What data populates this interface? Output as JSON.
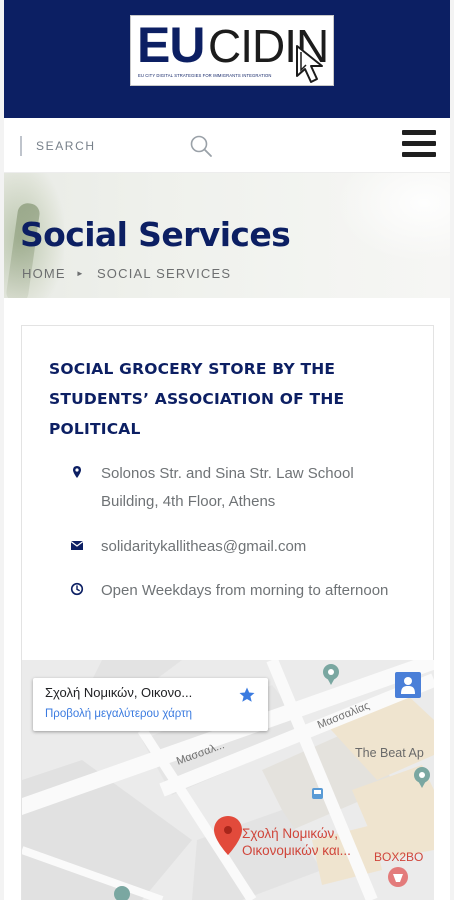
{
  "header": {
    "logo": {
      "part1": "EU",
      "part2": "CIDIN",
      "tagline": "EU CITY DIGITAL STRATEGIES FOR IMMIGRANTS INTEGRATION"
    },
    "colors": {
      "brand_navy": "#0c1f63",
      "white": "#ffffff"
    }
  },
  "search": {
    "placeholder": "SEARCH",
    "icon": "search-icon"
  },
  "menu": {
    "icon": "hamburger-menu-icon"
  },
  "hero": {
    "title": "Social Services",
    "breadcrumb": [
      "HOME",
      "SOCIAL SERVICES"
    ]
  },
  "card": {
    "title": "SOCIAL GROCERY STORE BY THE STUDENTS’ ASSOCIATION OF THE POLITICAL",
    "address": "Solonos Str. and Sina Str. Law School Building, 4th Floor, Athens",
    "email": "solidaritykallitheas@gmail.com",
    "hours": "Open Weekdays from morning to afternoon"
  },
  "map": {
    "place_name": "Σχολή Νομικών, Οικονο...",
    "view_larger": "Προβολή μεγαλύτερου χάρτη",
    "marker_label_line1": "Σχολή Νομικών,",
    "marker_label_line2": "Οικονομικών και...",
    "streets": [
      "Μασσαλίας",
      "Μασσαλ..."
    ],
    "places": [
      "The Beat Ap",
      "BOX2BO"
    ]
  }
}
